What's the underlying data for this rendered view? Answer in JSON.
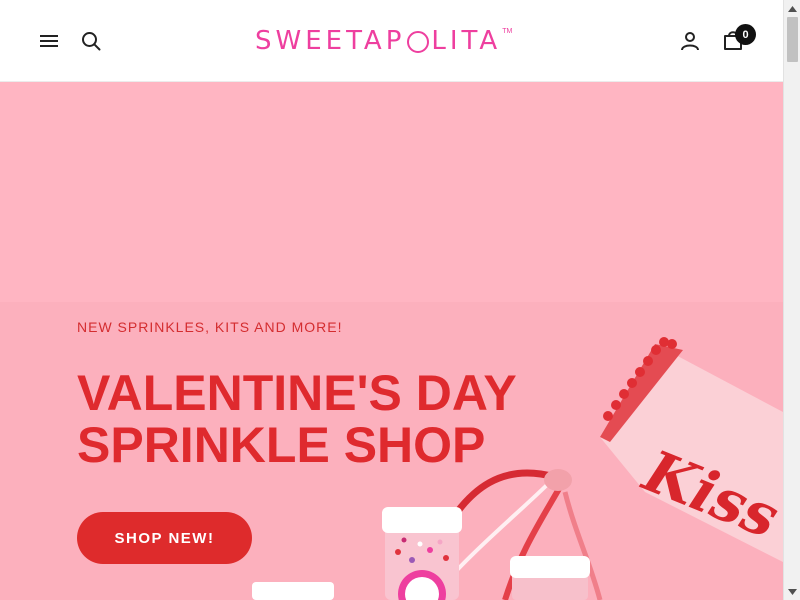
{
  "header": {
    "menu_icon": "hamburger-menu-icon",
    "search_icon": "search-icon",
    "logo": {
      "text_before": "SWEETAP",
      "text_after": "LITA",
      "trademark": "TM",
      "color": "#ee3f9f"
    },
    "account_icon": "user-icon",
    "cart_icon": "shopping-bag-icon",
    "cart_count": "0"
  },
  "hero": {
    "eyebrow": "NEW SPRINKLES, KITS AND MORE!",
    "headline_line1": "VALENTINE'S DAY",
    "headline_line2": "SPRINKLE SHOP",
    "cta_label": "SHOP NEW!",
    "banner_text": "Kiss",
    "colors": {
      "background": "#ffb5c2",
      "headline": "#df2a2e",
      "button": "#de2b2c"
    }
  }
}
